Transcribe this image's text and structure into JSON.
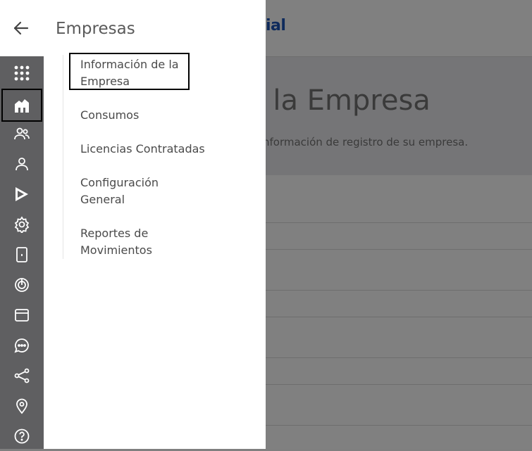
{
  "background": {
    "brand": "ial",
    "title": "e la Empresa",
    "subtitle": "nformación de registro de su empresa."
  },
  "drawer": {
    "title": "Empresas",
    "items": [
      {
        "label": "Información de la Empresa"
      },
      {
        "label": "Consumos"
      },
      {
        "label": "Licencias Contratadas"
      },
      {
        "label": "Configuración General"
      },
      {
        "label": "Reportes de Movimientos"
      }
    ]
  },
  "rail": {
    "icons": [
      "grid-icon",
      "company-icon",
      "users-icon",
      "user-icon",
      "play-store-icon",
      "settings-icon",
      "device-icon",
      "target-icon",
      "window-icon",
      "chat-icon",
      "share-icon",
      "location-icon",
      "help-icon"
    ]
  },
  "colors": {
    "overlay": "#808080",
    "rail": "#5f5f61",
    "brand": "#0e2a5c"
  }
}
